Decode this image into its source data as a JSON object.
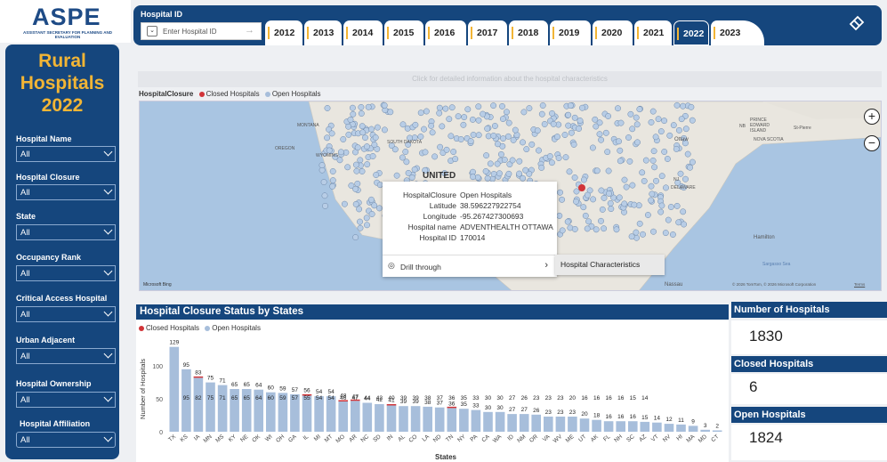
{
  "logo": {
    "text": "ASPE",
    "subtitle": "ASSISTANT SECRETARY FOR PLANNING AND EVALUATION"
  },
  "sidebar": {
    "title_lines": [
      "Rural",
      "Hospitals",
      "2022"
    ],
    "filters": [
      {
        "label": "Hospital Name",
        "value": "All"
      },
      {
        "label": "Hospital Closure",
        "value": "All"
      },
      {
        "label": "State",
        "value": "All"
      },
      {
        "label": "Occupancy Rank",
        "value": "All"
      },
      {
        "label": "Critical Access Hospital",
        "value": "All"
      },
      {
        "label": "Urban Adjacent",
        "value": "All"
      },
      {
        "label": "Hospital Ownership",
        "value": "All"
      },
      {
        "label": "Hospital Affiliation",
        "value": "All"
      }
    ]
  },
  "header": {
    "hospital_id_label": "Hospital ID",
    "search_placeholder": "Enter Hospital ID",
    "search_arrow": "→",
    "tabs": [
      "2012",
      "2013",
      "2014",
      "2015",
      "2016",
      "2017",
      "2018",
      "2019",
      "2020",
      "2021",
      "2022",
      "2023"
    ],
    "active_tab": "2022"
  },
  "banner": "Click for detailed information about the hospital characteristics",
  "map": {
    "legend_title": "HospitalClosure",
    "legend_items": [
      {
        "label": "Closed Hospitals",
        "color": "#d13438"
      },
      {
        "label": "Open Hospitals",
        "color": "#a7bedb"
      }
    ],
    "tooltip": {
      "rows": [
        {
          "key": "HospitalClosure",
          "value": "Open Hospitals"
        },
        {
          "key": "Latitude",
          "value": "38.596227922754"
        },
        {
          "key": "Longitude",
          "value": "-95.267427300693"
        },
        {
          "key": "Hospital name",
          "value": "ADVENTHEALTH OTTAWA"
        },
        {
          "key": "Hospital ID",
          "value": "170014"
        }
      ],
      "drill_through": "Drill through",
      "drill_target": "Hospital Characteristics"
    },
    "labels": {
      "ottawa": "Ottaw",
      "pei": "PRINCE EDWARD ISLAND",
      "nb": "NB",
      "ns": "NOVA SCOTIA",
      "stpierre": "St-Pierre",
      "hamilton": "Hamilton",
      "sargasso": "Sargasso Sea",
      "nassau": "Nassau",
      "delaware": "DELAWARE",
      "nj": "NJ",
      "montana": "MONTANA",
      "wyoming": "WYOMING",
      "oregon": "OREGON",
      "southdakota": "SOUTH DAKOTA",
      "united": "UNITED",
      "bing": "Microsoft Bing",
      "copyright": "© 2026 TomTom, © 2026 Microsoft Corporation",
      "terms": "Terms"
    },
    "zoom_in": "+",
    "zoom_out": "−"
  },
  "chart": {
    "title": "Hospital Closure Status by States"
  },
  "chart_data": {
    "type": "bar",
    "title": "Hospital Closure Status by States",
    "xlabel": "States",
    "ylabel": "Number of Hospitals",
    "yticks": [
      0,
      50,
      100
    ],
    "ylim": [
      0,
      130
    ],
    "categories": [
      "TX",
      "KS",
      "IA",
      "MN",
      "MS",
      "KY",
      "NE",
      "OK",
      "WI",
      "OH",
      "GA",
      "IL",
      "MI",
      "MT",
      "MO",
      "AR",
      "NC",
      "SD",
      "IN",
      "AL",
      "CO",
      "LA",
      "ND",
      "TN",
      "NY",
      "PA",
      "CA",
      "WA",
      "ID",
      "NM",
      "OR",
      "VA",
      "WV",
      "ME",
      "UT",
      "AK",
      "FL",
      "NH",
      "SC",
      "AZ",
      "VT",
      "NV",
      "HI",
      "MA",
      "MD",
      "CT"
    ],
    "totals": [
      129,
      95,
      83,
      75,
      71,
      65,
      65,
      64,
      60,
      59,
      57,
      56,
      54,
      54,
      48,
      47,
      44,
      42,
      41,
      39,
      39,
      38,
      37,
      36,
      35,
      33,
      30,
      30,
      27,
      27,
      26,
      23,
      23,
      23,
      20,
      18,
      16,
      16,
      16,
      15,
      14,
      12,
      11,
      9,
      3,
      2
    ],
    "series": [
      {
        "name": "Closed Hospitals",
        "color": "#d13438",
        "values": [
          0,
          0,
          1,
          0,
          0,
          0,
          0,
          0,
          0,
          0,
          0,
          1,
          0,
          0,
          2,
          1,
          0,
          0,
          1,
          0,
          0,
          0,
          0,
          1,
          0,
          0,
          0,
          0,
          0,
          0,
          0,
          0,
          0,
          0,
          0,
          0,
          0,
          0,
          0,
          0,
          0,
          0,
          0,
          0,
          0,
          0
        ]
      },
      {
        "name": "Open Hospitals",
        "color": "#a7bedb",
        "values": [
          129,
          95,
          82,
          75,
          71,
          65,
          65,
          64,
          60,
          59,
          57,
          55,
          54,
          54,
          46,
          47,
          44,
          42,
          40,
          39,
          39,
          38,
          37,
          36,
          35,
          33,
          30,
          30,
          27,
          27,
          26,
          23,
          23,
          23,
          20,
          18,
          16,
          16,
          16,
          15,
          14,
          12,
          11,
          9,
          3,
          2
        ]
      }
    ],
    "inner_labels": [
      "",
      "95",
      "82",
      "75",
      "71",
      "65",
      "65",
      "64",
      "60",
      "59",
      "57",
      "55",
      "54",
      "54",
      "46",
      "47",
      "44",
      "42",
      "40",
      "39",
      "39",
      "38",
      "37",
      "36",
      "35",
      "33",
      "30",
      "30",
      "27",
      "26",
      "23",
      "23",
      "23",
      "20",
      "16",
      "16",
      "16",
      "16",
      "15",
      "14",
      "",
      "",
      "",
      "",
      "",
      ""
    ],
    "legend": "top-left"
  },
  "kpis": [
    {
      "label": "Number of Hospitals",
      "value": "1830"
    },
    {
      "label": "Closed Hospitals",
      "value": "6"
    },
    {
      "label": "Open Hospitals",
      "value": "1824"
    }
  ]
}
